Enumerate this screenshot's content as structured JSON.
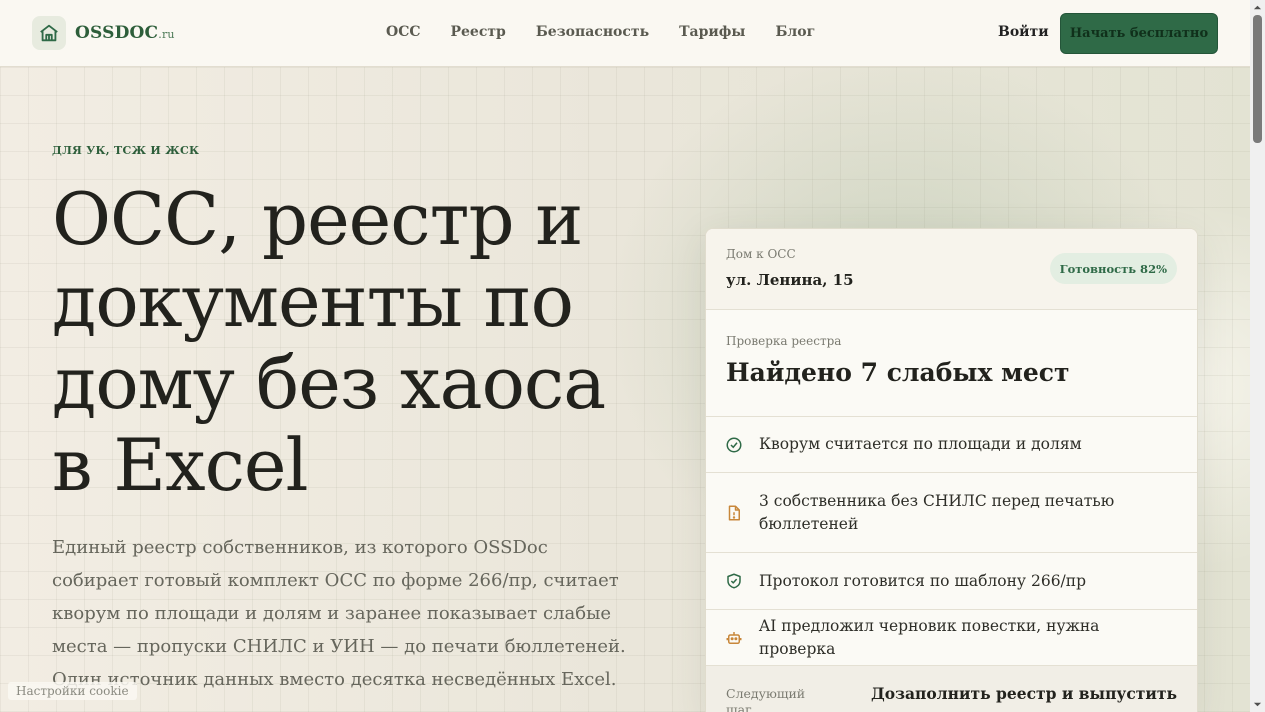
{
  "header": {
    "logo_text": "OSSDOC",
    "logo_suffix": ".ru",
    "nav": [
      "ОСС",
      "Реестр",
      "Безопасность",
      "Тарифы",
      "Блог"
    ],
    "login": "Войти",
    "cta": "Начать бесплатно"
  },
  "hero": {
    "eyebrow": "ДЛЯ УК, ТСЖ И ЖСК",
    "title": "ОСС, реестр и документы по дому без хаоса в Excel",
    "description": "Единый реестр собственников, из которого OSSDoc собирает готовый комплект ОСС по форме 266/пр, считает кворум по площади и долям и заранее показывает слабые места — пропуски СНИЛС и УИН — до печати бюллетеней. Один источник данных вместо десятка несведённых Excel."
  },
  "card": {
    "house_label": "Дом к ОСС",
    "house_name": "ул. Ленина, 15",
    "badge": "Готовность 82%",
    "readiness_percent": 82,
    "check_label": "Проверка реестра",
    "check_title": "Найдено 7 слабых мест",
    "items": [
      {
        "text": "Кворум считается по площади и долям",
        "icon": "check-circle-icon"
      },
      {
        "text": "3 собственника без СНИЛС перед печатью бюллетеней",
        "icon": "document-alert-icon"
      },
      {
        "text": "Протокол готовится по шаблону 266/пр",
        "icon": "shield-check-icon"
      },
      {
        "text": "AI предложил черновик повестки, нужна проверка",
        "icon": "robot-icon"
      }
    ],
    "next_label": "Следующий шаг",
    "next_text": "Дозаполнить реестр и выпустить"
  },
  "cookie": "Настройки cookie",
  "colors": {
    "accent": "#2f6a47",
    "warning": "#c8873a",
    "background": "#f3efe6"
  }
}
